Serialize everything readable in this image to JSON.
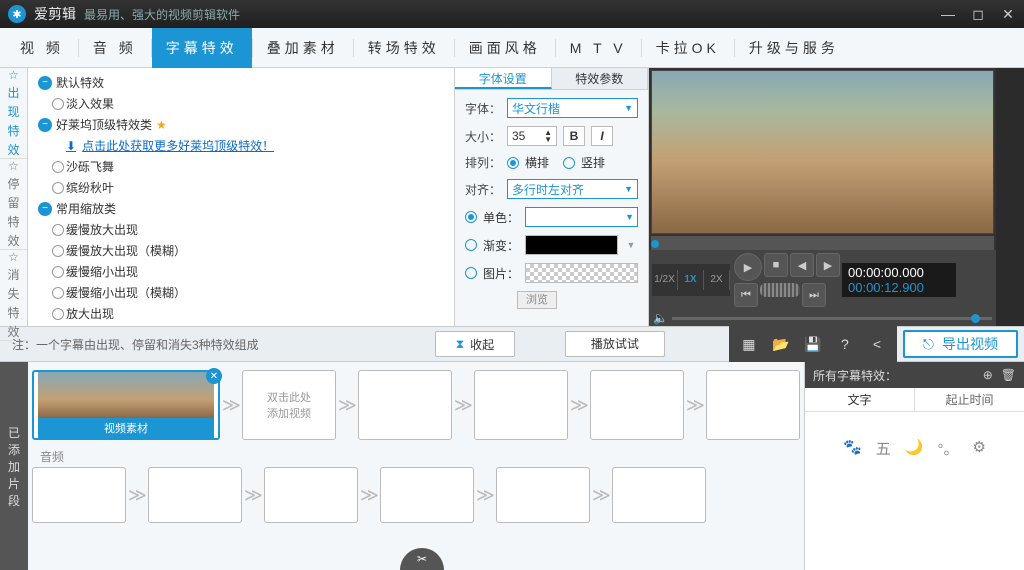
{
  "app": {
    "title": "爱剪辑",
    "tagline": "最易用、强大的视频剪辑软件"
  },
  "tabs": {
    "items": [
      "视 频",
      "音 频",
      "字幕特效",
      "叠加素材",
      "转场特效",
      "画面风格",
      "M T V",
      "卡拉OK",
      "升级与服务"
    ],
    "active": 2
  },
  "leftTabs": {
    "items": [
      "出现特效",
      "停留特效",
      "消失特效"
    ],
    "active": 0
  },
  "fxGroups": [
    {
      "name": "默认特效",
      "items": [
        {
          "label": "淡入效果"
        }
      ]
    },
    {
      "name": "好莱坞顶级特效类",
      "starred": true,
      "items": [
        {
          "label": "点击此处获取更多好莱坞顶级特效！",
          "link": true
        },
        {
          "label": "沙砾飞舞"
        },
        {
          "label": "缤纷秋叶"
        }
      ]
    },
    {
      "name": "常用缩放类",
      "items": [
        {
          "label": "缓慢放大出现"
        },
        {
          "label": "缓慢放大出现（模糊）"
        },
        {
          "label": "缓慢缩小出现"
        },
        {
          "label": "缓慢缩小出现（模糊）"
        },
        {
          "label": "放大出现"
        }
      ]
    }
  ],
  "settings": {
    "tabs": [
      "字体设置",
      "特效参数"
    ],
    "font_label": "字体：",
    "font_value": "华文行楷",
    "size_label": "大小：",
    "size_value": "35",
    "arrange_label": "排列：",
    "arrange_h": "横排",
    "arrange_v": "竖排",
    "align_label": "对齐：",
    "align_value": "多行时左对齐",
    "single_label": "单色：",
    "gradient_label": "渐变：",
    "image_label": "图片：",
    "browse": "浏览"
  },
  "midbar": {
    "note": "注：一个字幕由出现、停留和消失3种特效组成",
    "collapse": "收起",
    "playtest": "播放试试"
  },
  "preview": {
    "speeds": [
      "1/2X",
      "1X",
      "2X"
    ],
    "speedActive": 1,
    "current": "00:00:00.000",
    "duration": "00:00:12.900"
  },
  "export": "导出视频",
  "bottomTab": "已添加片段",
  "clip": {
    "label": "视频素材",
    "placeholder": "双击此处\n添加视频",
    "audio": "音频"
  },
  "fxpanel": {
    "title": "所有字幕特效：",
    "tabs": [
      "文字",
      "起止时间"
    ]
  }
}
